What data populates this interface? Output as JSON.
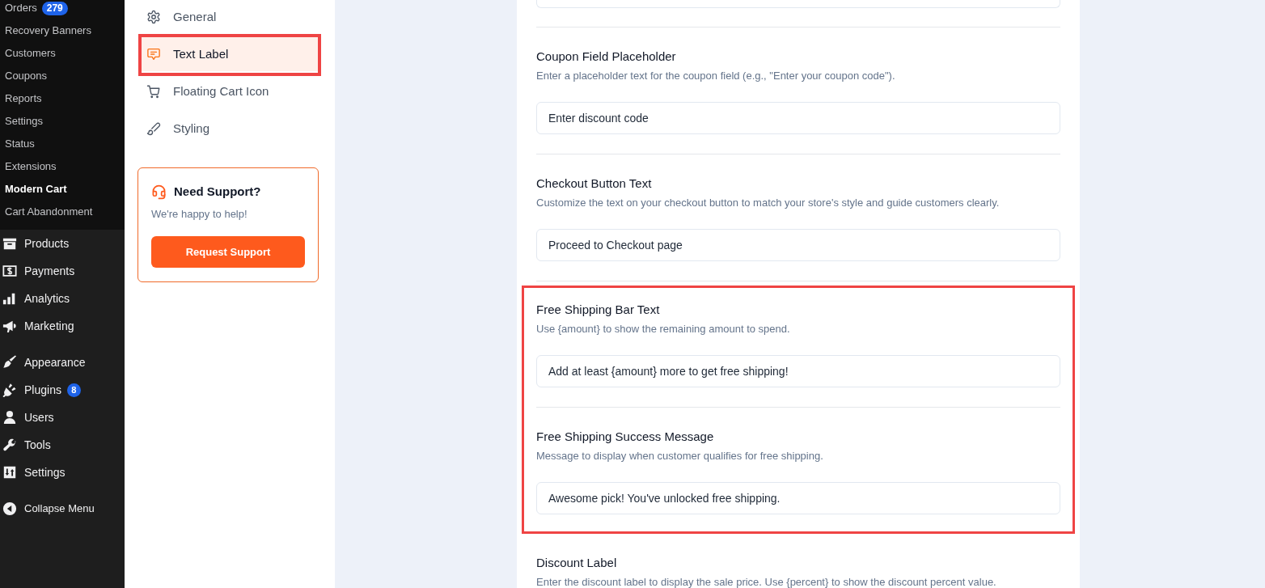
{
  "admin_menu": {
    "submenu": [
      {
        "label": "Orders",
        "badge": "279",
        "selected": false
      },
      {
        "label": "Recovery Banners",
        "selected": false
      },
      {
        "label": "Customers",
        "selected": false
      },
      {
        "label": "Coupons",
        "selected": false
      },
      {
        "label": "Reports",
        "selected": false
      },
      {
        "label": "Settings",
        "selected": false
      },
      {
        "label": "Status",
        "selected": false
      },
      {
        "label": "Extensions",
        "selected": false
      },
      {
        "label": "Modern Cart",
        "selected": true
      },
      {
        "label": "Cart Abandonment",
        "selected": false
      }
    ],
    "groups": [
      [
        {
          "label": "Products"
        },
        {
          "label": "Payments"
        },
        {
          "label": "Analytics"
        },
        {
          "label": "Marketing"
        }
      ],
      [
        {
          "label": "Appearance"
        },
        {
          "label": "Plugins",
          "badge": "8"
        },
        {
          "label": "Users"
        },
        {
          "label": "Tools"
        },
        {
          "label": "Settings"
        }
      ]
    ],
    "collapse": {
      "label": "Collapse Menu"
    }
  },
  "settings_nav": {
    "items": [
      {
        "label": "General",
        "selected": false,
        "highlighted": false
      },
      {
        "label": "Text Label",
        "selected": true,
        "highlighted": true
      },
      {
        "label": "Floating Cart Icon",
        "selected": false,
        "highlighted": false
      },
      {
        "label": "Styling",
        "selected": false,
        "highlighted": false
      }
    ]
  },
  "support_card": {
    "title": "Need Support?",
    "text": "We're happy to help!",
    "button": "Request Support"
  },
  "form": {
    "cut_off_field_above": true,
    "groups": [
      {
        "highlighted": false,
        "fields": [
          {
            "title": "Coupon Field Placeholder",
            "description": "Enter a placeholder text for the coupon field (e.g., \"Enter your coupon code\").",
            "value": "Enter discount code"
          },
          {
            "title": "Checkout Button Text",
            "description": "Customize the text on your checkout button to match your store's style and guide customers clearly.",
            "value": "Proceed to Checkout page"
          }
        ]
      },
      {
        "highlighted": true,
        "fields": [
          {
            "title": "Free Shipping Bar Text",
            "description": "Use {amount} to show the remaining amount to spend.",
            "value": "Add at least {amount} more to get free shipping!"
          },
          {
            "title": "Free Shipping Success Message",
            "description": "Message to display when customer qualifies for free shipping.",
            "value": "Awesome pick! You've unlocked free shipping."
          }
        ]
      },
      {
        "highlighted": false,
        "fields": [
          {
            "title": "Discount Label",
            "description": "Enter the discount label to display the sale price. Use {percent} to show the discount percent value."
          }
        ]
      }
    ]
  }
}
